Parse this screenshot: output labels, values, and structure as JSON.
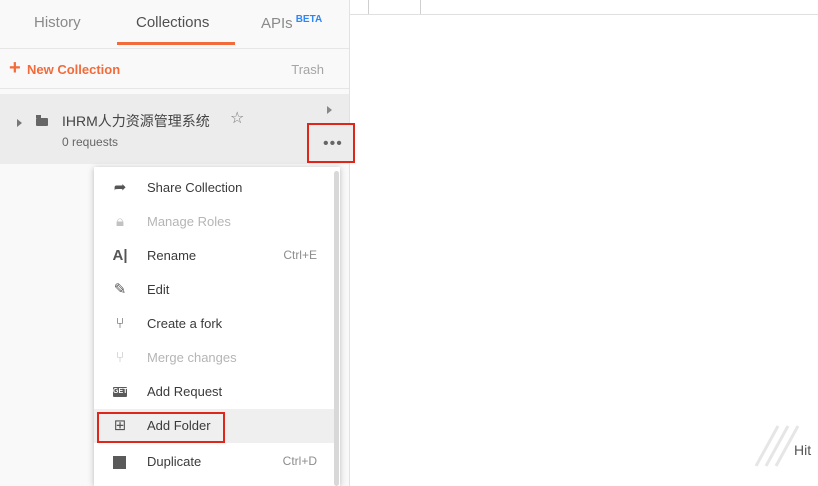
{
  "sidebar": {
    "tabs": [
      {
        "label": "History"
      },
      {
        "label": "Collections"
      },
      {
        "label": "APIs",
        "badge": "BETA"
      }
    ],
    "active_tab": "Collections",
    "new_collection_label": "New Collection",
    "trash_label": "Trash",
    "collection": {
      "name": "IHRM人力资源管理系统",
      "sub": "0 requests"
    }
  },
  "context_menu": {
    "items": [
      {
        "label": "Share Collection",
        "icon": "share-icon"
      },
      {
        "label": "Manage Roles",
        "icon": "lock-icon",
        "disabled": true
      },
      {
        "label": "Rename",
        "shortcut": "Ctrl+E",
        "icon": "rename-icon"
      },
      {
        "label": "Edit",
        "icon": "pencil-icon"
      },
      {
        "label": "Create a fork",
        "icon": "fork-icon"
      },
      {
        "label": "Merge changes",
        "icon": "merge-icon",
        "disabled": true
      },
      {
        "label": "Add Request",
        "icon": "get-request-icon",
        "icon_text": "GET"
      },
      {
        "label": "Add Folder",
        "icon": "add-folder-icon"
      },
      {
        "label": "Duplicate",
        "shortcut": "Ctrl+D",
        "icon": "duplicate-icon"
      }
    ]
  },
  "main": {
    "hint_text": "Hit"
  },
  "colors": {
    "accent": "#f26b3a",
    "highlight": "#e0251b",
    "beta": "#2f86f6"
  }
}
